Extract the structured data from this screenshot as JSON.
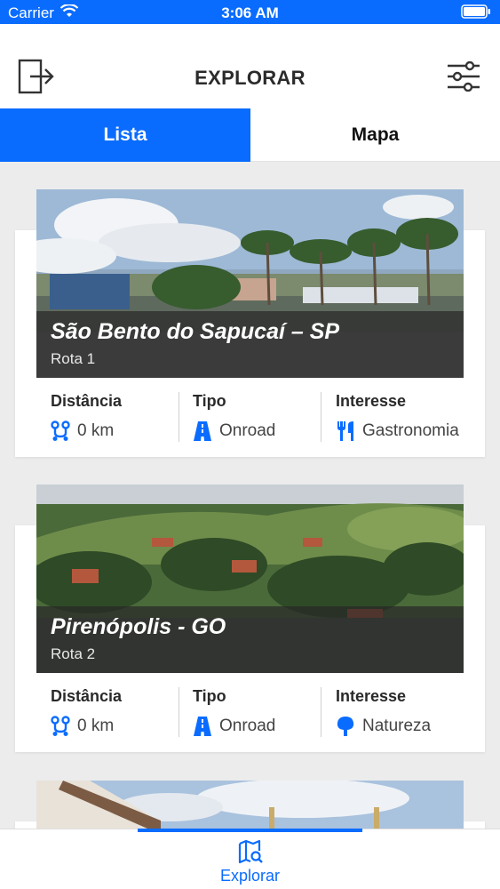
{
  "status_bar": {
    "carrier": "Carrier",
    "time": "3:06 AM"
  },
  "header": {
    "title": "EXPLORAR",
    "left_icon": "logout-icon",
    "right_icon": "filter-sliders-icon"
  },
  "segments": {
    "left_label": "Lista",
    "right_label": "Mapa",
    "active": "Lista"
  },
  "routes": [
    {
      "city": "São Bento do Sapucaí – SP",
      "route": "Rota 1",
      "distance_label": "Distância",
      "distance_value": "0 km",
      "type_label": "Tipo",
      "type_value": "Onroad",
      "interest_label": "Interesse",
      "interest_value": "Gastronomia",
      "interest_icon": "fork-knife-icon"
    },
    {
      "city": "Pirenópolis - GO",
      "route": "Rota 2",
      "distance_label": "Distância",
      "distance_value": "0 km",
      "type_label": "Tipo",
      "type_value": "Onroad",
      "interest_label": "Interesse",
      "interest_value": "Natureza",
      "interest_icon": "tree-icon"
    }
  ],
  "tab_bar": {
    "active_label": "Explorar",
    "icon": "map-search-icon"
  },
  "colors": {
    "accent": "#0a6cff",
    "background": "#ececed"
  }
}
